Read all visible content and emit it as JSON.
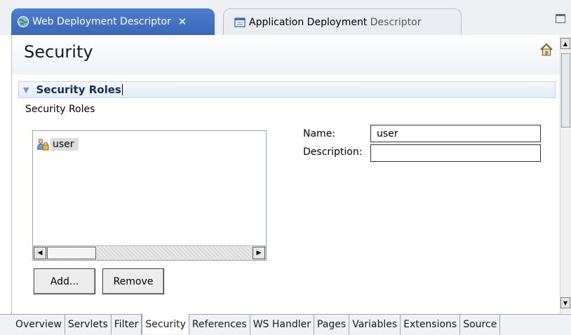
{
  "tabs": {
    "web": {
      "label": "Web Deployment Descriptor",
      "icon": "globe-icon",
      "close_icon": "close-icon"
    },
    "app": {
      "label_main": "Application Deployment",
      "label_rest": " Descriptor",
      "icon": "descriptor-icon"
    }
  },
  "page": {
    "title": "Security",
    "home_icon": "home-icon"
  },
  "section": {
    "title": "Security Roles",
    "description": "Security Roles"
  },
  "roles": [
    {
      "label": "user",
      "icon": "role-lock-icon"
    }
  ],
  "buttons": {
    "add": "Add...",
    "remove": "Remove"
  },
  "form": {
    "name_label": "Name:",
    "name_value": "user",
    "description_label": "Description:",
    "description_value": ""
  },
  "bottom_tabs": [
    {
      "label": "Overview",
      "active": false
    },
    {
      "label": "Servlets",
      "active": false
    },
    {
      "label": "Filter",
      "active": false
    },
    {
      "label": "Security",
      "active": true
    },
    {
      "label": "References",
      "active": false
    },
    {
      "label": "WS Handler",
      "active": false
    },
    {
      "label": "Pages",
      "active": false
    },
    {
      "label": "Variables",
      "active": false
    },
    {
      "label": "Extensions",
      "active": false
    },
    {
      "label": "Source",
      "active": false
    }
  ],
  "colors": {
    "active_tab": "#3a67b8",
    "section_title": "#1a2d55"
  }
}
